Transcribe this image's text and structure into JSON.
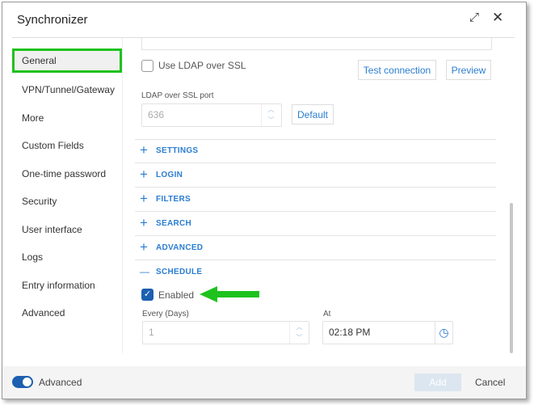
{
  "dialog": {
    "title": "Synchronizer",
    "expand_icon": "expand-icon",
    "close_icon": "close-icon"
  },
  "sidebar": {
    "items": [
      {
        "label": "General",
        "active": true
      },
      {
        "label": "VPN/Tunnel/Gateway"
      },
      {
        "label": "More"
      },
      {
        "label": "Custom Fields"
      },
      {
        "label": "One-time password"
      },
      {
        "label": "Security"
      },
      {
        "label": "User interface"
      },
      {
        "label": "Logs"
      },
      {
        "label": "Entry information"
      },
      {
        "label": "Advanced"
      }
    ]
  },
  "content": {
    "use_ldap_ssl": {
      "label": "Use LDAP over SSL",
      "checked": false
    },
    "test_connection": "Test connection",
    "preview": "Preview",
    "ssl_port": {
      "label": "LDAP over SSL port",
      "value": "636"
    },
    "default": "Default",
    "sections": [
      {
        "label": "SETTINGS",
        "sign": "+"
      },
      {
        "label": "LOGIN",
        "sign": "+"
      },
      {
        "label": "FILTERS",
        "sign": "+"
      },
      {
        "label": "SEARCH",
        "sign": "+"
      },
      {
        "label": "ADVANCED",
        "sign": "+"
      },
      {
        "label": "SCHEDULE",
        "sign": "—"
      }
    ],
    "schedule": {
      "enabled_label": "Enabled",
      "enabled": true,
      "every_label": "Every (Days)",
      "every_value": "1",
      "at_label": "At",
      "at_value": "02:18 PM"
    }
  },
  "footer": {
    "advanced_label": "Advanced",
    "advanced_on": true,
    "add": "Add",
    "cancel": "Cancel"
  },
  "colors": {
    "accent": "#2a7dd1",
    "highlight": "#1ec21e"
  }
}
